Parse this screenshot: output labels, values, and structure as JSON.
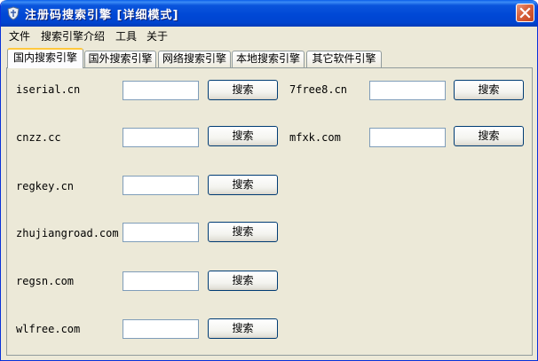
{
  "window": {
    "title": "注册码搜索引擎 [详细模式]"
  },
  "menu": [
    "文件",
    "搜索引擎介绍",
    "工具",
    "关于"
  ],
  "tabs": [
    "国内搜索引擎",
    "国外搜索引擎",
    "网络搜索引擎",
    "本地搜索引擎",
    "其它软件引擎"
  ],
  "active_tab": "国内搜索引擎",
  "search_label": "搜索",
  "left_sites": [
    "iserial.cn",
    "cnzz.cc",
    "regkey.cn",
    "zhujiangroad.com",
    "regsn.com",
    "wlfree.com"
  ],
  "right_sites": [
    "7free8.cn",
    "mfxk.com"
  ],
  "colors": {
    "title_bar": "#0054e3",
    "window_bg": "#ece9d8",
    "close_button": "#d9643e",
    "active_tab_accent": "#ffc83c"
  },
  "icons": {
    "app": "shield-app-icon",
    "close": "close-icon"
  }
}
